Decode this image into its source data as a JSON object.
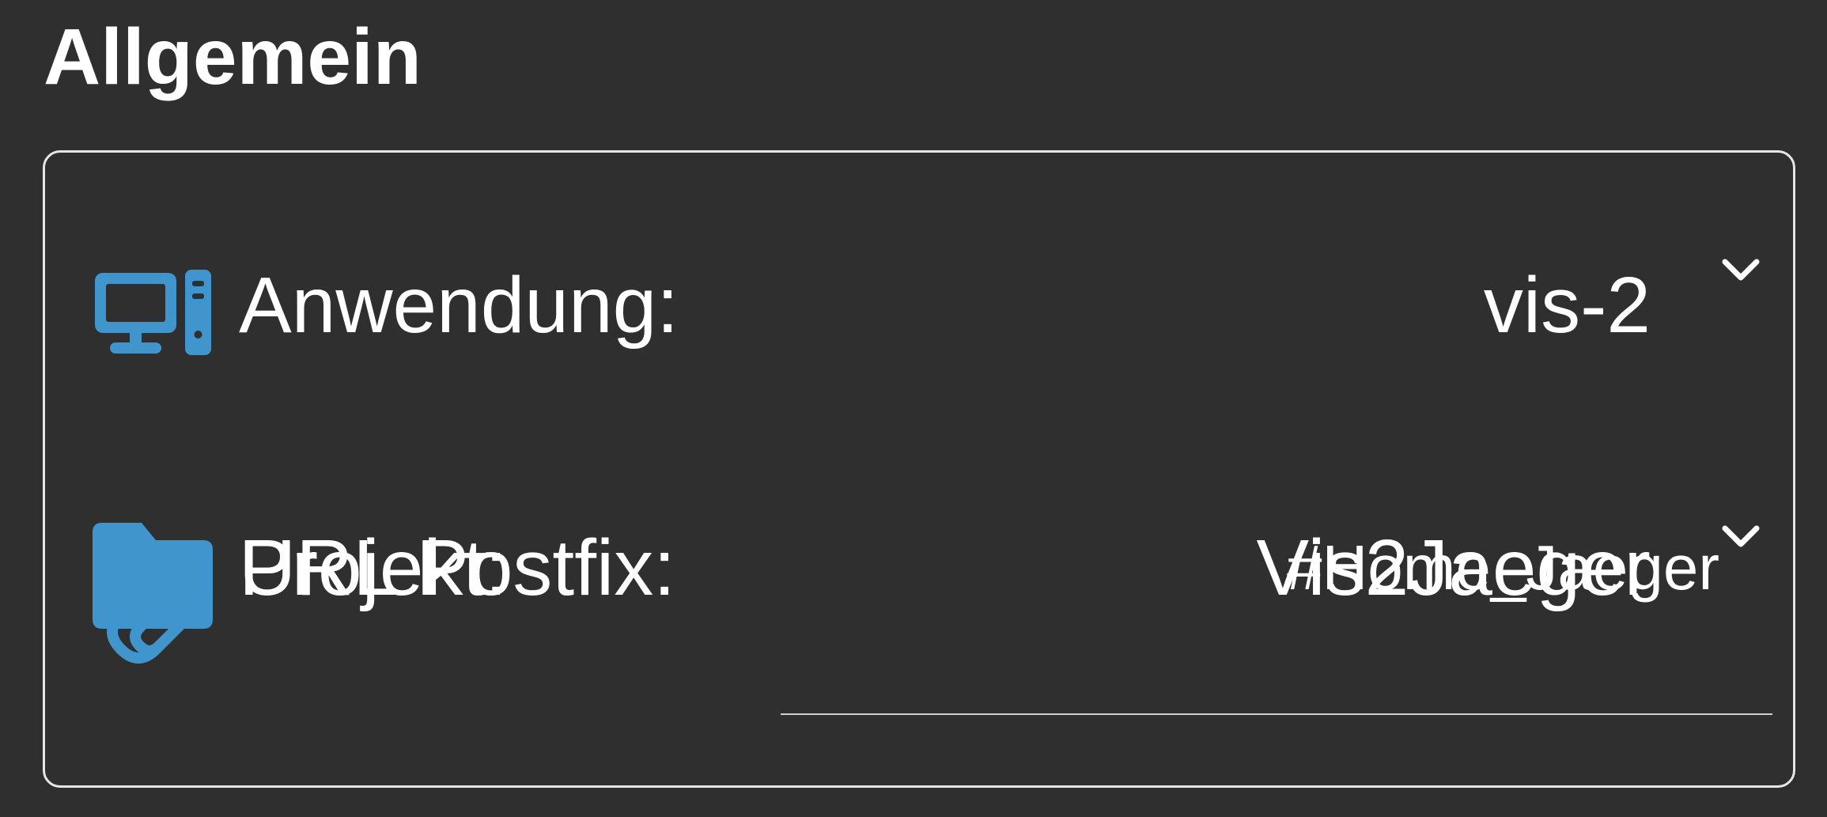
{
  "section": {
    "title": "Allgemein"
  },
  "fields": {
    "application": {
      "icon": "desktop-computer-icon",
      "label": "Anwendung:",
      "value": "vis-2"
    },
    "project": {
      "icon": "folder-icon",
      "label": "Projekt:",
      "value": "Vis2Jaeger"
    },
    "url_postfix": {
      "icon": "paperclip-icon",
      "label": "URL Postfix:",
      "value": "#Home_Jaeger"
    }
  },
  "colors": {
    "background": "#2f2f2f",
    "icon_accent": "#3f95cc",
    "text": "#ffffff",
    "border": "#e6e6e6"
  }
}
